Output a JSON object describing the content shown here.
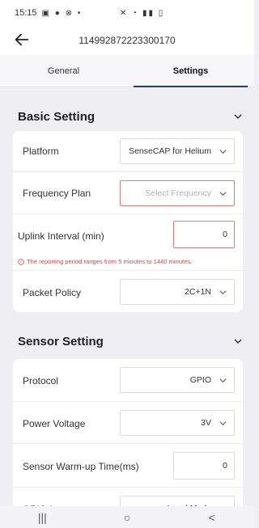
{
  "status": {
    "time": "15:15",
    "left_icons": "▣ ● ⊗ •",
    "right_icons": "✕ ◔ ▮▮ ▯"
  },
  "header": {
    "device_id": "114992872223300170"
  },
  "tabs": [
    {
      "label": "General",
      "active": false
    },
    {
      "label": "Settings",
      "active": true
    }
  ],
  "basic": {
    "title": "Basic Setting",
    "platform_label": "Platform",
    "platform_value": "SenseCAP for Helium",
    "frequency_label": "Frequency Plan",
    "frequency_placeholder": "Select Frequency",
    "uplink_label": "Uplink Interval (min)",
    "uplink_value": "0",
    "uplink_error": "The reporting period ranges from 5 minutes to 1440 minutes.",
    "packet_label": "Packet Policy",
    "packet_value": "2C+1N"
  },
  "sensor": {
    "title": "Sensor Setting",
    "protocol_label": "Protocol",
    "protocol_value": "GPIO",
    "voltage_label": "Power Voltage",
    "voltage_value": "3V",
    "warmup_label": "Sensor Warm-up Time(ms)",
    "warmup_value": "0",
    "gpio_label": "GPIO Input",
    "gpio_value": "Level Mode"
  },
  "nav": {
    "recents": "|||",
    "home": "○",
    "back": "<"
  },
  "colors": {
    "accent": "#1f3b78",
    "error": "#d64545",
    "background": "#efeff3"
  }
}
